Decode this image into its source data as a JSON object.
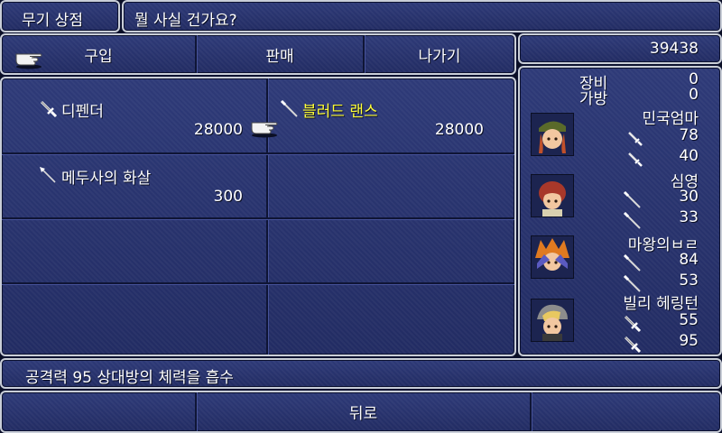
{
  "header": {
    "shop_title": "무기 상점",
    "prompt": "뭘 사실 건가요?"
  },
  "menu": {
    "buy": "구입",
    "sell": "판매",
    "exit": "나가기"
  },
  "gold": "39438",
  "items": [
    {
      "name": "디펜더",
      "price": "28000",
      "icon": "sword-icon",
      "selected": false
    },
    {
      "name": "블러드 랜스",
      "price": "28000",
      "icon": "spear-icon",
      "selected": true
    },
    {
      "name": "메두사의 화살",
      "price": "300",
      "icon": "arrow-icon",
      "selected": false
    }
  ],
  "stats": {
    "equipped_label": "장비",
    "equipped_value": "0",
    "bag_label": "가방",
    "bag_value": "0"
  },
  "party": [
    {
      "name": "민국엄마",
      "val1": "78",
      "val2": "40",
      "icon1": "dagger-icon",
      "icon2": "dagger-icon"
    },
    {
      "name": "심영",
      "val1": "30",
      "val2": "33",
      "icon1": "spear-icon",
      "icon2": "spear-icon"
    },
    {
      "name": "마왕의ㅂㄹ",
      "val1": "84",
      "val2": "53",
      "icon1": "spear-icon",
      "icon2": "spear-icon"
    },
    {
      "name": "빌리 헤링턴",
      "val1": "55",
      "val2": "95",
      "icon1": "sword-icon",
      "icon2": "sword-icon"
    }
  ],
  "description": "공격력 95 상대방의 체력을 흡수",
  "back": "뒤로",
  "colors": {
    "window_bg": "#27326b",
    "border": "#c9ced8",
    "highlight_text": "#ffff3a"
  }
}
